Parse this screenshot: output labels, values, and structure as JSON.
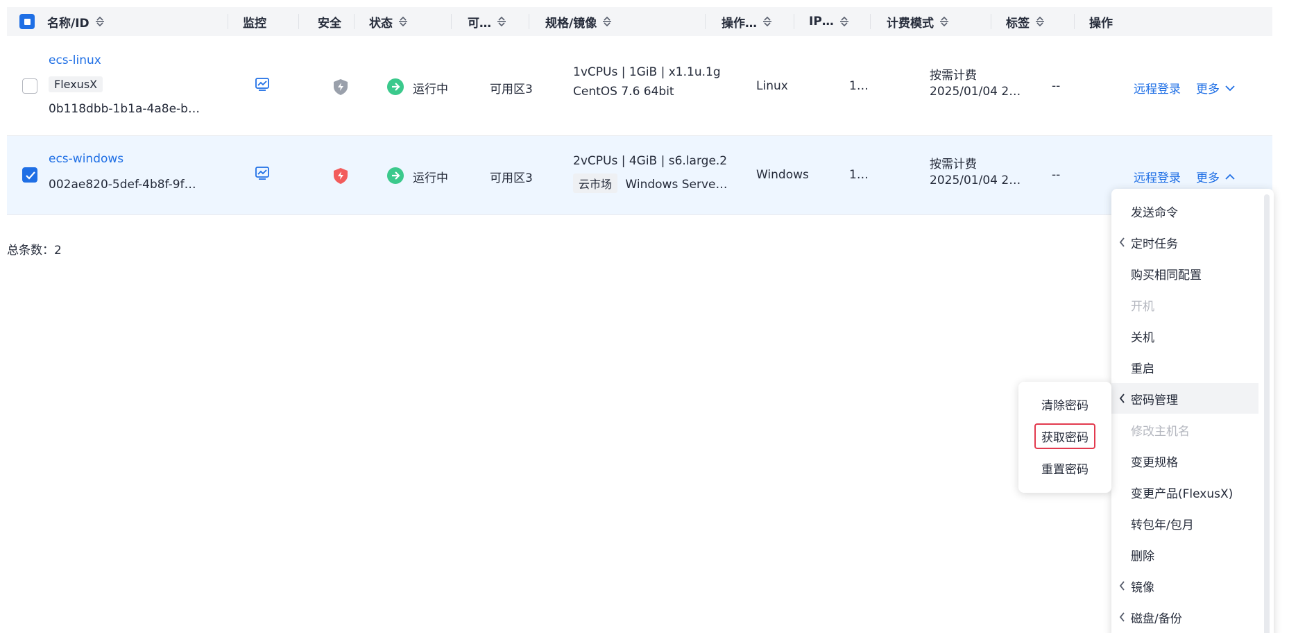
{
  "header": {
    "name_id": "名称/ID",
    "monitor": "监控",
    "security": "安全",
    "status": "状态",
    "az": "可…",
    "spec_image": "规格/镜像",
    "os": "操作…",
    "ip": "IP…",
    "billing": "计费模式",
    "tags": "标签",
    "actions": "操作"
  },
  "rows": [
    {
      "name": "ecs-linux",
      "product_tag": "FlexusX",
      "id": "0b118dbb-1b1a-4a8e-b…",
      "status": "运行中",
      "az": "可用区3",
      "spec": "1vCPUs | 1GiB | x1.1u.1g",
      "image": "CentOS 7.6 64bit",
      "image_tag": "",
      "os": "Linux",
      "ip": "1…",
      "billing": "按需计费",
      "created": "2025/01/04 2…",
      "tags": "--",
      "remote_login": "远程登录",
      "more": "更多",
      "checked": false
    },
    {
      "name": "ecs-windows",
      "product_tag": "",
      "id": "002ae820-5def-4b8f-9f…",
      "status": "运行中",
      "az": "可用区3",
      "spec": "2vCPUs | 4GiB | s6.large.2",
      "image": "Windows Serve…",
      "image_tag": "云市场",
      "os": "Windows",
      "ip": "1…",
      "billing": "按需计费",
      "created": "2025/01/04 2…",
      "tags": "--",
      "remote_login": "远程登录",
      "more": "更多",
      "checked": true
    }
  ],
  "total_label": "总条数：2",
  "menu": {
    "items": [
      {
        "label": "发送命令",
        "submenu": false,
        "disabled": false
      },
      {
        "label": "定时任务",
        "submenu": true,
        "disabled": false
      },
      {
        "label": "购买相同配置",
        "submenu": false,
        "disabled": false
      },
      {
        "label": "开机",
        "submenu": false,
        "disabled": true
      },
      {
        "label": "关机",
        "submenu": false,
        "disabled": false
      },
      {
        "label": "重启",
        "submenu": false,
        "disabled": false
      },
      {
        "label": "密码管理",
        "submenu": true,
        "disabled": false
      },
      {
        "label": "修改主机名",
        "submenu": false,
        "disabled": true
      },
      {
        "label": "变更规格",
        "submenu": false,
        "disabled": false
      },
      {
        "label": "变更产品(FlexusX)",
        "submenu": false,
        "disabled": false
      },
      {
        "label": "转包年/包月",
        "submenu": false,
        "disabled": false
      },
      {
        "label": "删除",
        "submenu": false,
        "disabled": false
      },
      {
        "label": "镜像",
        "submenu": true,
        "disabled": false
      },
      {
        "label": "磁盘/备份",
        "submenu": true,
        "disabled": false
      }
    ]
  },
  "password_submenu": {
    "items": [
      "清除密码",
      "获取密码",
      "重置密码"
    ]
  },
  "colors": {
    "link": "#1f6fe5",
    "running": "#3bc98c",
    "shield_gray": "#9aa0ab",
    "shield_red": "#f25c5c",
    "highlight": "#e23a4e",
    "selected_row": "#eef6ff"
  }
}
